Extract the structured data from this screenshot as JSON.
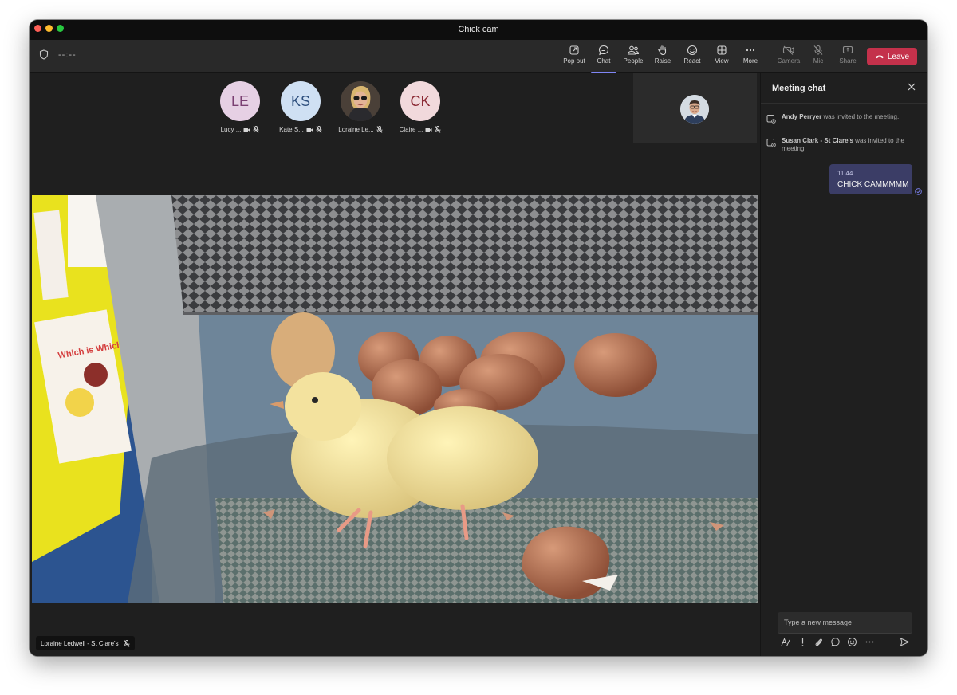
{
  "window": {
    "title": "Chick cam"
  },
  "toolbar": {
    "timer": "--:--",
    "buttons": {
      "popout": "Pop out",
      "chat": "Chat",
      "people": "People",
      "raise": "Raise",
      "react": "React",
      "view": "View",
      "more": "More",
      "camera": "Camera",
      "mic": "Mic",
      "share": "Share"
    },
    "leave": "Leave"
  },
  "participants": [
    {
      "initials": "LE",
      "name": "Lucy ...",
      "bg": "#e6d0e4",
      "fg": "#7a3f72"
    },
    {
      "initials": "KS",
      "name": "Kate S...",
      "bg": "#cfe0f3",
      "fg": "#2e4f7d"
    },
    {
      "initials": "",
      "name": "Loraine Le...",
      "bg": "#b8a48a",
      "fg": "#ffffff"
    },
    {
      "initials": "CK",
      "name": "Claire ...",
      "bg": "#f1d9dc",
      "fg": "#8c2b36"
    }
  ],
  "stage": {
    "speaker_name": "Loraine Ledwell - St Clare's"
  },
  "chat": {
    "title": "Meeting chat",
    "system_messages": [
      {
        "name": "Andy Perryer",
        "text": " was invited to the meeting."
      },
      {
        "name": "Susan Clark - St Clare's",
        "text": " was invited to the meeting."
      }
    ],
    "message": {
      "time": "11:44",
      "text": "CHICK CAMMMMM"
    },
    "compose_placeholder": "Type a new message"
  },
  "colors": {
    "accent": "#7f85f5",
    "leave": "#c4314b",
    "bubble": "#3b3d66"
  }
}
